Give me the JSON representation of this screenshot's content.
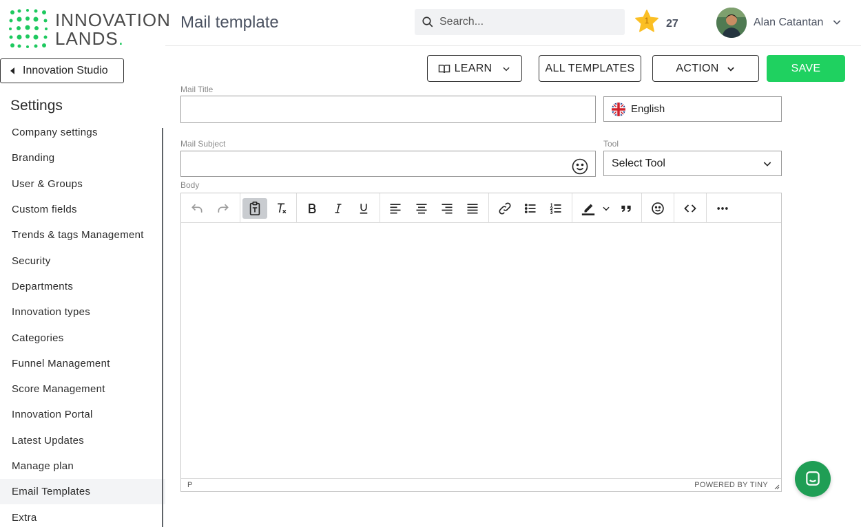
{
  "brand": {
    "line1": "INNOVATION",
    "line2": "LANDS",
    "accent": "#1ec95f"
  },
  "sidebar": {
    "back_button": "Innovation Studio",
    "heading": "Settings",
    "items": [
      {
        "label": "Company settings"
      },
      {
        "label": "Branding"
      },
      {
        "label": "User & Groups"
      },
      {
        "label": "Custom fields"
      },
      {
        "label": "Trends & tags Management"
      },
      {
        "label": "Security"
      },
      {
        "label": "Departments"
      },
      {
        "label": "Innovation types"
      },
      {
        "label": "Categories"
      },
      {
        "label": "Funnel Management"
      },
      {
        "label": "Score Management"
      },
      {
        "label": "Innovation Portal"
      },
      {
        "label": "Latest Updates"
      },
      {
        "label": "Manage plan"
      },
      {
        "label": "Email Templates",
        "active": true
      },
      {
        "label": "Extra"
      }
    ]
  },
  "header": {
    "title": "Mail template",
    "search_placeholder": "Search...",
    "level": "1",
    "points": "27",
    "user_name": "Alan Catantan"
  },
  "actions": {
    "learn": "LEARN",
    "all_templates": "ALL TEMPLATES",
    "action": "ACTION",
    "save": "SAVE",
    "save_color": "#1fd160"
  },
  "form": {
    "mail_title_label": "Mail Title",
    "mail_title_value": "",
    "language": "English",
    "mail_subject_label": "Mail Subject",
    "mail_subject_value": "",
    "tool_label": "Tool",
    "tool_value": "Select Tool",
    "body_label": "Body"
  },
  "editor": {
    "toolbar": [
      "undo-icon",
      "redo-icon",
      "paste-as-text-icon",
      "clear-formatting-icon",
      "bold-icon",
      "italic-icon",
      "underline-icon",
      "align-left-icon",
      "align-center-icon",
      "align-right-icon",
      "justify-icon",
      "link-icon",
      "bullet-list-icon",
      "numbered-list-icon",
      "highlight-icon",
      "blockquote-icon",
      "emoticons-icon",
      "source-code-icon",
      "more-icon"
    ],
    "status_path": "P",
    "powered_by": "POWERED BY TINY"
  }
}
